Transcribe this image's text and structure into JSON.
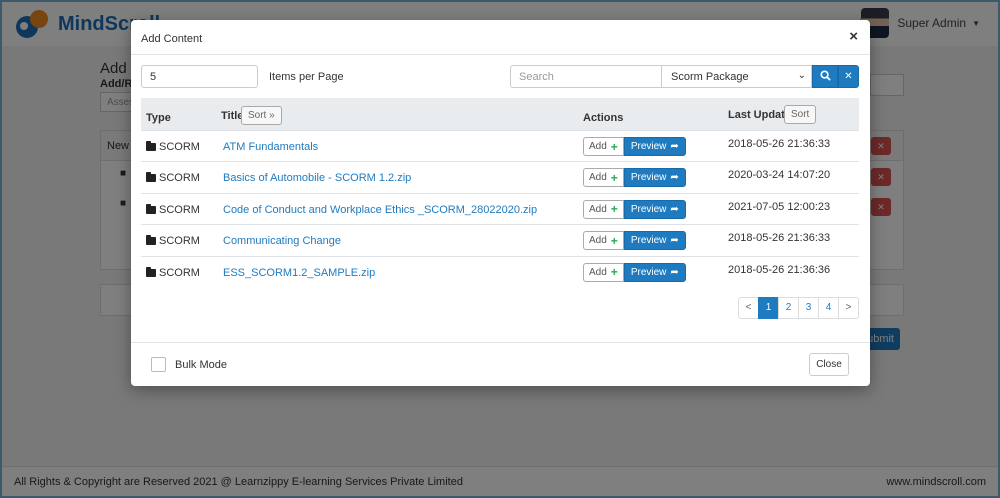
{
  "app": {
    "logo_text": "MindScroll",
    "user_name": "Super Admin"
  },
  "background": {
    "page_title": "Add Co",
    "sub_label": "Add/Ren",
    "input_placeholder": "Assess",
    "panel_header": "New S",
    "submit_label": "ubmit"
  },
  "footer": {
    "copyright": "All Rights & Copyright are Reserved 2021 @ Learnzippy E-learning Services Private Limited",
    "site": "www.mindscroll.com"
  },
  "modal": {
    "title": "Add Content",
    "items_per_page": "5",
    "items_per_page_label": "Items per Page",
    "search_placeholder": "Search",
    "content_type_selected": "Scorm Package",
    "columns": {
      "type": "Type",
      "title": "Title",
      "actions": "Actions",
      "last_updated": "Last Updated"
    },
    "sort_label": "Sort",
    "add_label": "Add",
    "preview_label": "Preview",
    "rows": [
      {
        "type": "SCORM",
        "title": "ATM Fundamentals",
        "updated": "2018-05-26 21:36:33"
      },
      {
        "type": "SCORM",
        "title": "Basics of Automobile - SCORM 1.2.zip",
        "updated": "2020-03-24 14:07:20"
      },
      {
        "type": "SCORM",
        "title": "Code of Conduct and Workplace Ethics _SCORM_28022020.zip",
        "updated": "2021-07-05 12:00:23"
      },
      {
        "type": "SCORM",
        "title": "Communicating Change",
        "updated": "2018-05-26 21:36:33"
      },
      {
        "type": "SCORM",
        "title": "ESS_SCORM1.2_SAMPLE.zip",
        "updated": "2018-05-26 21:36:36"
      }
    ],
    "pagination": {
      "prev": "<",
      "pages": [
        "1",
        "2",
        "3",
        "4"
      ],
      "next": ">",
      "current": "1"
    },
    "bulk_mode_label": "Bulk Mode",
    "close_label": "Close"
  },
  "colors": {
    "primary": "#1f7bbf",
    "danger": "#d9534f",
    "success": "#2da94f"
  }
}
